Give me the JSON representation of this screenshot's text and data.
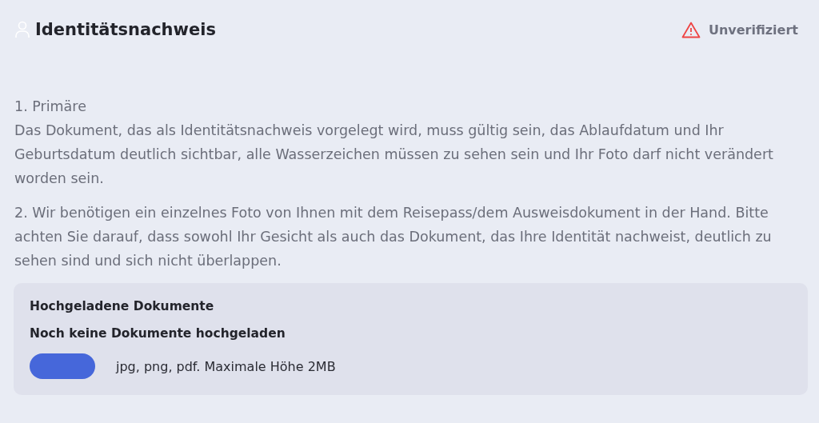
{
  "header": {
    "title": "Identitätsnachweis",
    "status": "Unverifiziert"
  },
  "instructions": [
    {
      "title": "1. Primäre",
      "text": "Das Dokument, das als Identitätsnachweis vorgelegt wird, muss gültig sein, das Ablaufdatum und Ihr Geburtsdatum deutlich sichtbar, alle Wasserzeichen müssen zu sehen sein und Ihr Foto darf nicht verändert worden sein."
    },
    {
      "text": "2. Wir benötigen ein einzelnes Foto von Ihnen mit dem Reisepass/dem Ausweisdokument in der Hand. Bitte achten Sie darauf, dass sowohl Ihr Gesicht als auch das Dokument, das Ihre Identität nachweist, deutlich zu sehen sind und sich nicht überlappen."
    }
  ],
  "uploads": {
    "title": "Hochgeladene Dokumente",
    "empty_message": "Noch keine Dokumente hochgeladen",
    "hint": "jpg, png, pdf. Maximale Höhe 2MB"
  }
}
